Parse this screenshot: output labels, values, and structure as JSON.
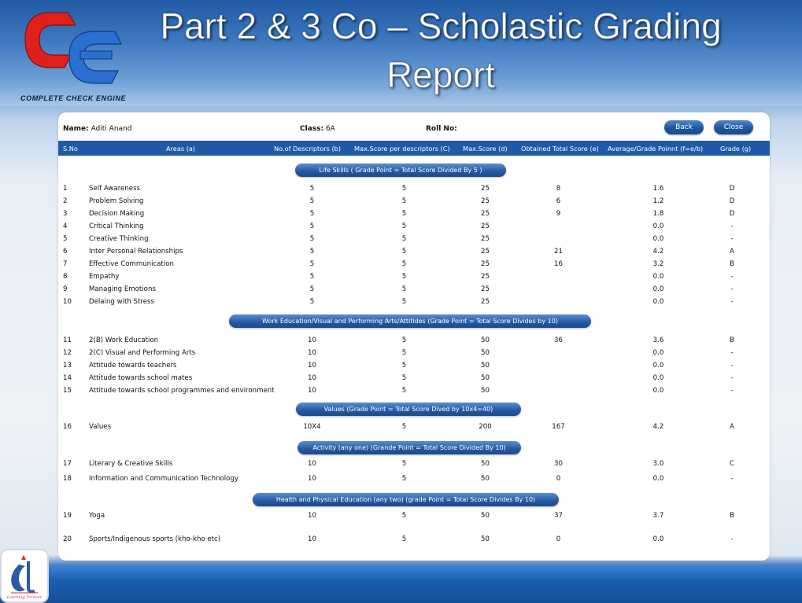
{
  "header": {
    "title": "Part 2 & 3 Co – Scholastic Grading Report",
    "logo_caption": "COMPLETE CHECK ENGINE",
    "footer_logo_caption": "Learning Forever"
  },
  "student": {
    "name_label": "Name:",
    "name_value": "Aditi Anand",
    "class_label": "Class:",
    "class_value": "6A",
    "roll_label": "Roll No:",
    "roll_value": ""
  },
  "buttons": {
    "back": "Back",
    "close": "Close"
  },
  "columns": {
    "sno": "S.No",
    "areas": "Areas (a)",
    "desc": "No.of Descriptors (b)",
    "max_per": "Max.Score per descriptors (C)",
    "max": "Max.Score (d)",
    "obtained": "Obtained Total Score (e)",
    "avg": "Average/Grade Poinnt (f=e/b)",
    "grade": "Grade (g)"
  },
  "sections": [
    "Life Skills ( Grade Point = Total Score Divided By 5 )",
    "Work Education/Visual and Performing Arts/Attitides (Grade Point = Total Score Divides by 10)",
    "Values (Grade Point = Total Score Dived by 10x4=40)",
    "Activity (any one) (Grande Point = Total Score Divided By 10)",
    "Health and Physical Education (any two) (grade Point = Total Score Divides By 10)"
  ],
  "rows": [
    [
      "1",
      "Self Awareness",
      "5",
      "5",
      "25",
      "8",
      "1.6",
      "D"
    ],
    [
      "2",
      "Problem Solving",
      "5",
      "5",
      "25",
      "6",
      "1.2",
      "D"
    ],
    [
      "3",
      "Decision Making",
      "5",
      "5",
      "25",
      "9",
      "1.8",
      "D"
    ],
    [
      "4",
      "Critical Thinking",
      "5",
      "5",
      "25",
      "",
      "0.0",
      "-"
    ],
    [
      "5",
      "Creative Thinking",
      "5",
      "5",
      "25",
      "",
      "0.0",
      "-"
    ],
    [
      "6",
      "Inter Personal Relationships",
      "5",
      "5",
      "25",
      "21",
      "4.2",
      "A"
    ],
    [
      "7",
      "Effective Communication",
      "5",
      "5",
      "25",
      "16",
      "3.2",
      "B"
    ],
    [
      "8",
      "Empathy",
      "5",
      "5",
      "25",
      "",
      "0.0",
      "-"
    ],
    [
      "9",
      "Managing Emotions",
      "5",
      "5",
      "25",
      "",
      "0.0",
      "-"
    ],
    [
      "10",
      "Delaing with Stress",
      "5",
      "5",
      "25",
      "",
      "0.0",
      "-"
    ],
    [
      "11",
      "2(B) Work Education",
      "10",
      "5",
      "50",
      "36",
      "3.6",
      "B"
    ],
    [
      "12",
      "2(C) Visual and Performing Arts",
      "10",
      "5",
      "50",
      "",
      "0.0",
      "-"
    ],
    [
      "13",
      "Attitude towards teachers",
      "10",
      "5",
      "50",
      "",
      "0.0",
      "-"
    ],
    [
      "14",
      "Attitude towards school mates",
      "10",
      "5",
      "50",
      "",
      "0.0",
      "-"
    ],
    [
      "15",
      "Attitude towards school programmes and environment",
      "10",
      "5",
      "50",
      "",
      "0.0",
      "-"
    ],
    [
      "16",
      "Values",
      "10X4",
      "5",
      "200",
      "167",
      "4.2",
      "A"
    ],
    [
      "17",
      "Literary & Creative Skills",
      "10",
      "5",
      "50",
      "30",
      "3.0",
      "C"
    ],
    [
      "18",
      "Information and Communication Technology",
      "10",
      "5",
      "50",
      "0",
      "0.0",
      "-"
    ],
    [
      "19",
      "Yoga",
      "10",
      "5",
      "50",
      "37",
      "3.7",
      "B"
    ],
    [
      "20",
      "Sports/Indigenous sports (kho-kho etc)",
      "10",
      "5",
      "50",
      "0",
      "0.0",
      "-"
    ]
  ],
  "colors": {
    "header_blue": "#1f5aa6",
    "logo_red": "#e0201b",
    "logo_blue": "#2b6fd0"
  },
  "icons": {
    "brand_logo": "cce-logo-icon",
    "footer_logo": "al-logo-icon"
  }
}
